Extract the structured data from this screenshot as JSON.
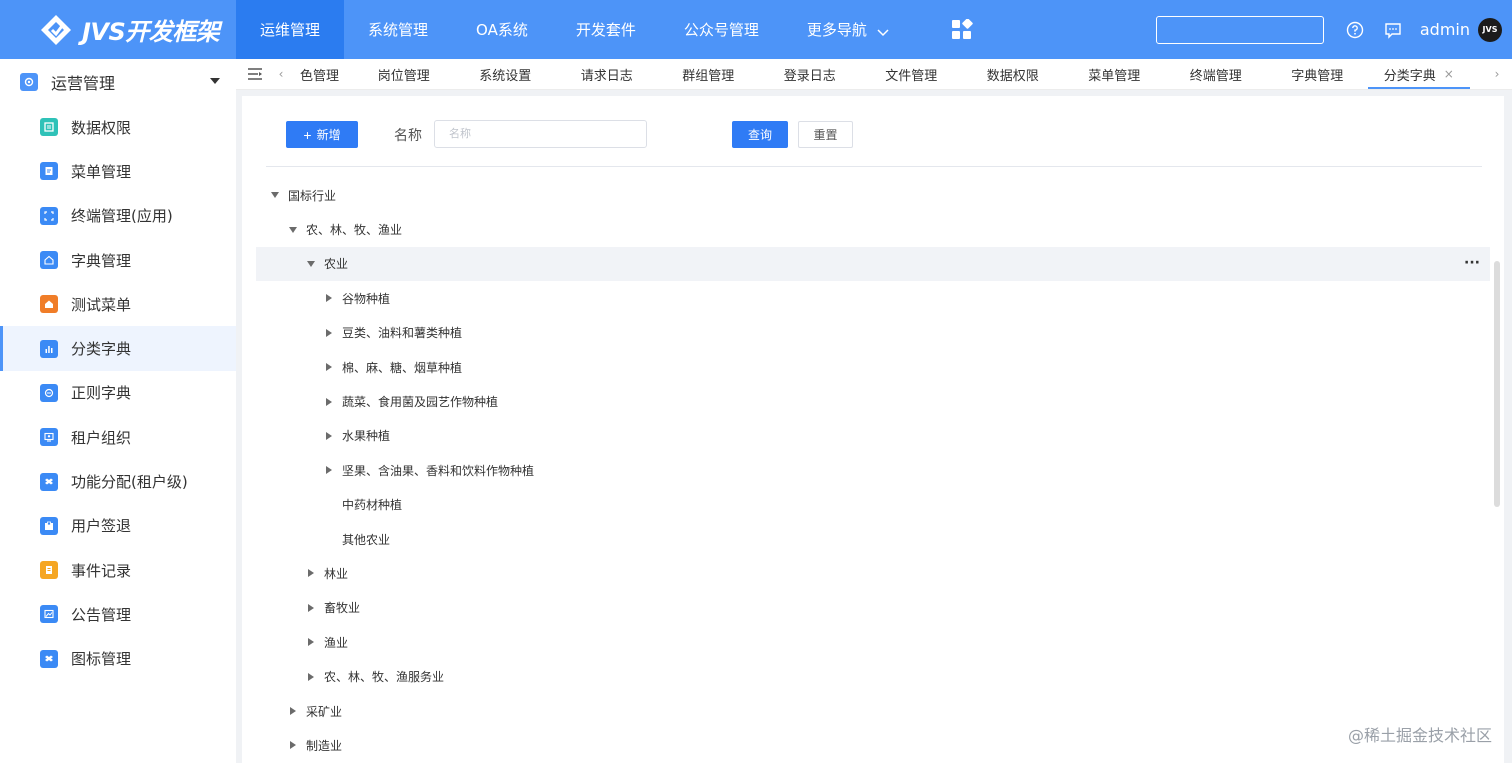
{
  "brand": {
    "name": "JVS开发框架"
  },
  "topnav": {
    "items": [
      {
        "label": "运维管理",
        "active": true
      },
      {
        "label": "系统管理"
      },
      {
        "label": "OA系统"
      },
      {
        "label": "开发套件"
      },
      {
        "label": "公众号管理"
      },
      {
        "label": "更多导航",
        "dropdown": true
      }
    ]
  },
  "topright": {
    "search_value": "",
    "help_icon": "help-icon",
    "message_icon": "message-icon",
    "username": "admin",
    "avatar_text": "JVS"
  },
  "sidebar": {
    "group": {
      "label": "运营管理",
      "icon": "gear-icon"
    },
    "items": [
      {
        "label": "数据权限",
        "color": "#2fc2b8"
      },
      {
        "label": "菜单管理",
        "color": "#3b8af5"
      },
      {
        "label": "终端管理(应用)",
        "color": "#3b8af5"
      },
      {
        "label": "字典管理",
        "color": "#3b8af5"
      },
      {
        "label": "测试菜单",
        "color": "#f07d28"
      },
      {
        "label": "分类字典",
        "color": "#3b8af5",
        "active": true
      },
      {
        "label": "正则字典",
        "color": "#3b8af5"
      },
      {
        "label": "租户组织",
        "color": "#3b8af5"
      },
      {
        "label": "功能分配(租户级)",
        "color": "#3b8af5"
      },
      {
        "label": "用户签退",
        "color": "#3b8af5"
      },
      {
        "label": "事件记录",
        "color": "#f5a623"
      },
      {
        "label": "公告管理",
        "color": "#3b8af5"
      },
      {
        "label": "图标管理",
        "color": "#3b8af5"
      }
    ]
  },
  "tabs": {
    "items": [
      {
        "label": "色管理"
      },
      {
        "label": "岗位管理"
      },
      {
        "label": "系统设置"
      },
      {
        "label": "请求日志"
      },
      {
        "label": "群组管理"
      },
      {
        "label": "登录日志"
      },
      {
        "label": "文件管理"
      },
      {
        "label": "数据权限"
      },
      {
        "label": "菜单管理"
      },
      {
        "label": "终端管理"
      },
      {
        "label": "字典管理"
      },
      {
        "label": "分类字典",
        "active": true,
        "closable": true
      }
    ],
    "close_glyph": "×"
  },
  "toolbar": {
    "add_label": "新增",
    "name_label": "名称",
    "name_placeholder": "名称",
    "name_value": "",
    "query_label": "查询",
    "reset_label": "重置"
  },
  "tree": [
    {
      "label": "国标行业",
      "level": 0,
      "state": "expanded"
    },
    {
      "label": "农、林、牧、渔业",
      "level": 1,
      "state": "expanded"
    },
    {
      "label": "农业",
      "level": 2,
      "state": "expanded",
      "highlighted": true,
      "more": "···"
    },
    {
      "label": "谷物种植",
      "level": 3,
      "state": "collapsed"
    },
    {
      "label": "豆类、油料和薯类种植",
      "level": 3,
      "state": "collapsed"
    },
    {
      "label": "棉、麻、糖、烟草种植",
      "level": 3,
      "state": "collapsed"
    },
    {
      "label": "蔬菜、食用菌及园艺作物种植",
      "level": 3,
      "state": "collapsed"
    },
    {
      "label": "水果种植",
      "level": 3,
      "state": "collapsed"
    },
    {
      "label": "坚果、含油果、香料和饮料作物种植",
      "level": 3,
      "state": "collapsed"
    },
    {
      "label": "中药材种植",
      "level": 3,
      "state": "leaf"
    },
    {
      "label": "其他农业",
      "level": 3,
      "state": "leaf"
    },
    {
      "label": "林业",
      "level": 2,
      "state": "collapsed"
    },
    {
      "label": "畜牧业",
      "level": 2,
      "state": "collapsed"
    },
    {
      "label": "渔业",
      "level": 2,
      "state": "collapsed"
    },
    {
      "label": "农、林、牧、渔服务业",
      "level": 2,
      "state": "collapsed"
    },
    {
      "label": "采矿业",
      "level": 1,
      "state": "collapsed"
    },
    {
      "label": "制造业",
      "level": 1,
      "state": "collapsed"
    }
  ],
  "watermark": "@稀土掘金技术社区"
}
